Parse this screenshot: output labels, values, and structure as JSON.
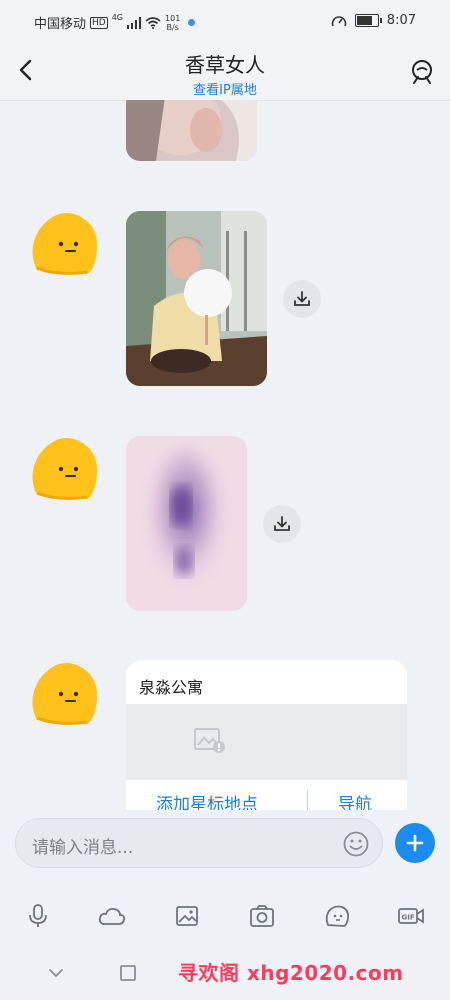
{
  "status_bar": {
    "carrier": "中国移动",
    "hd": "HD",
    "net": "4G",
    "speed_value": "101",
    "speed_unit": "B/s",
    "time": "8:07",
    "battery_level": 0.85
  },
  "header": {
    "title": "香草女人",
    "subtitle": "查看IP属地"
  },
  "messages": [
    {
      "type": "image",
      "desc": "photo"
    },
    {
      "type": "image",
      "desc": "photo"
    },
    {
      "type": "image",
      "desc": "blurred photo"
    },
    {
      "type": "location"
    }
  ],
  "location_card": {
    "title": "泉淼公寓",
    "action_star": "添加星标地点",
    "action_nav": "导航"
  },
  "input": {
    "placeholder": "请输入消息..."
  },
  "toolbar": [
    "mic-icon",
    "cloud-icon",
    "image-icon",
    "camera-icon",
    "emoji-face-icon",
    "gif-video-icon"
  ],
  "watermark": "寻欢阁 xhg2020.com",
  "colors": {
    "accent": "#1a8cf0",
    "link": "#1a7fe0",
    "avatar": "#ffc21a",
    "watermark": "#ff3b5c"
  }
}
